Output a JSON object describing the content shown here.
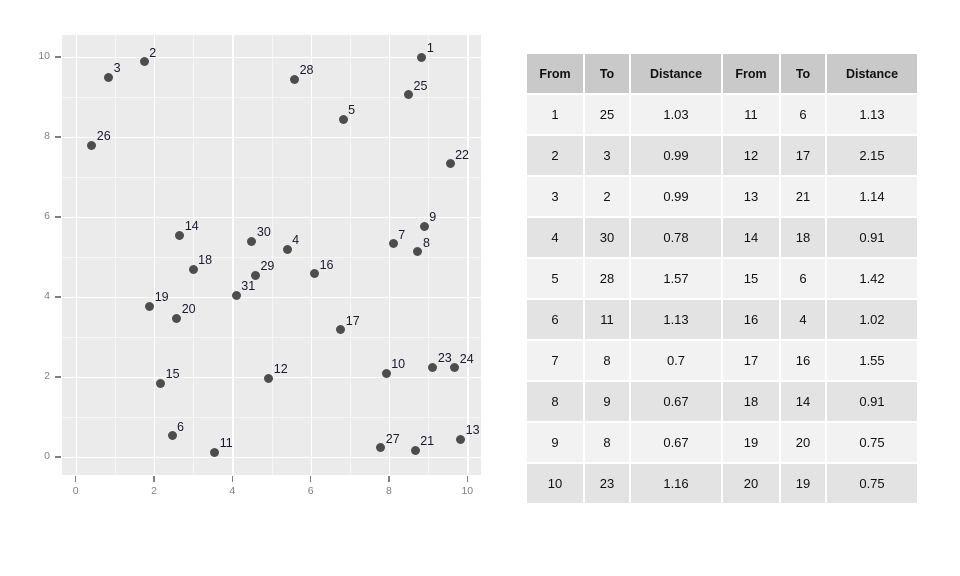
{
  "chart_data": {
    "type": "scatter",
    "title": "",
    "xlabel": "",
    "ylabel": "",
    "xlim": [
      -0.35,
      10.35
    ],
    "ylim": [
      -0.45,
      10.55
    ],
    "xticks": [
      "0",
      "2",
      "4",
      "6",
      "8",
      "10"
    ],
    "xtick_values": [
      0,
      2,
      4,
      6,
      8,
      10
    ],
    "yticks": [
      "0",
      "2",
      "4",
      "6",
      "8",
      "10"
    ],
    "ytick_values": [
      0,
      2,
      4,
      6,
      8,
      10
    ],
    "grid": true,
    "legend": "none",
    "point_color": "#4d4d4d",
    "panel_color": "#ebebeb",
    "label_color": "#1a1a2e",
    "points": [
      {
        "label": "1",
        "x": 8.84,
        "y": 9.99
      },
      {
        "label": "2",
        "x": 1.75,
        "y": 9.88
      },
      {
        "label": "3",
        "x": 0.84,
        "y": 9.5
      },
      {
        "label": "4",
        "x": 5.4,
        "y": 5.2
      },
      {
        "label": "5",
        "x": 6.83,
        "y": 8.44
      },
      {
        "label": "6",
        "x": 2.46,
        "y": 0.53
      },
      {
        "label": "7",
        "x": 8.11,
        "y": 5.33
      },
      {
        "label": "8",
        "x": 8.74,
        "y": 5.13
      },
      {
        "label": "9",
        "x": 8.9,
        "y": 5.77
      },
      {
        "label": "10",
        "x": 7.93,
        "y": 2.1
      },
      {
        "label": "11",
        "x": 3.55,
        "y": 0.12
      },
      {
        "label": "12",
        "x": 4.93,
        "y": 1.97
      },
      {
        "label": "13",
        "x": 9.83,
        "y": 0.45
      },
      {
        "label": "14",
        "x": 2.66,
        "y": 5.54
      },
      {
        "label": "15",
        "x": 2.17,
        "y": 1.85
      },
      {
        "label": "16",
        "x": 6.1,
        "y": 4.58
      },
      {
        "label": "17",
        "x": 6.77,
        "y": 3.18
      },
      {
        "label": "18",
        "x": 3.0,
        "y": 4.69
      },
      {
        "label": "19",
        "x": 1.89,
        "y": 3.77
      },
      {
        "label": "20",
        "x": 2.58,
        "y": 3.47
      },
      {
        "label": "21",
        "x": 8.67,
        "y": 0.17
      },
      {
        "label": "22",
        "x": 9.56,
        "y": 7.33
      },
      {
        "label": "23",
        "x": 9.12,
        "y": 2.25
      },
      {
        "label": "24",
        "x": 9.68,
        "y": 2.23
      },
      {
        "label": "25",
        "x": 8.5,
        "y": 9.06
      },
      {
        "label": "26",
        "x": 0.41,
        "y": 7.79
      },
      {
        "label": "27",
        "x": 7.79,
        "y": 0.23
      },
      {
        "label": "28",
        "x": 5.59,
        "y": 9.44
      },
      {
        "label": "29",
        "x": 4.59,
        "y": 4.55
      },
      {
        "label": "30",
        "x": 4.5,
        "y": 5.4
      },
      {
        "label": "31",
        "x": 4.1,
        "y": 4.05
      }
    ]
  },
  "table": {
    "headers": [
      "From",
      "To",
      "Distance",
      "From",
      "To",
      "Distance"
    ],
    "rows": [
      [
        "1",
        "25",
        "1.03",
        "11",
        "6",
        "1.13"
      ],
      [
        "2",
        "3",
        "0.99",
        "12",
        "17",
        "2.15"
      ],
      [
        "3",
        "2",
        "0.99",
        "13",
        "21",
        "1.14"
      ],
      [
        "4",
        "30",
        "0.78",
        "14",
        "18",
        "0.91"
      ],
      [
        "5",
        "28",
        "1.57",
        "15",
        "6",
        "1.42"
      ],
      [
        "6",
        "11",
        "1.13",
        "16",
        "4",
        "1.02"
      ],
      [
        "7",
        "8",
        "0.7",
        "17",
        "16",
        "1.55"
      ],
      [
        "8",
        "9",
        "0.67",
        "18",
        "14",
        "0.91"
      ],
      [
        "9",
        "8",
        "0.67",
        "19",
        "20",
        "0.75"
      ],
      [
        "10",
        "23",
        "1.16",
        "20",
        "19",
        "0.75"
      ]
    ]
  }
}
